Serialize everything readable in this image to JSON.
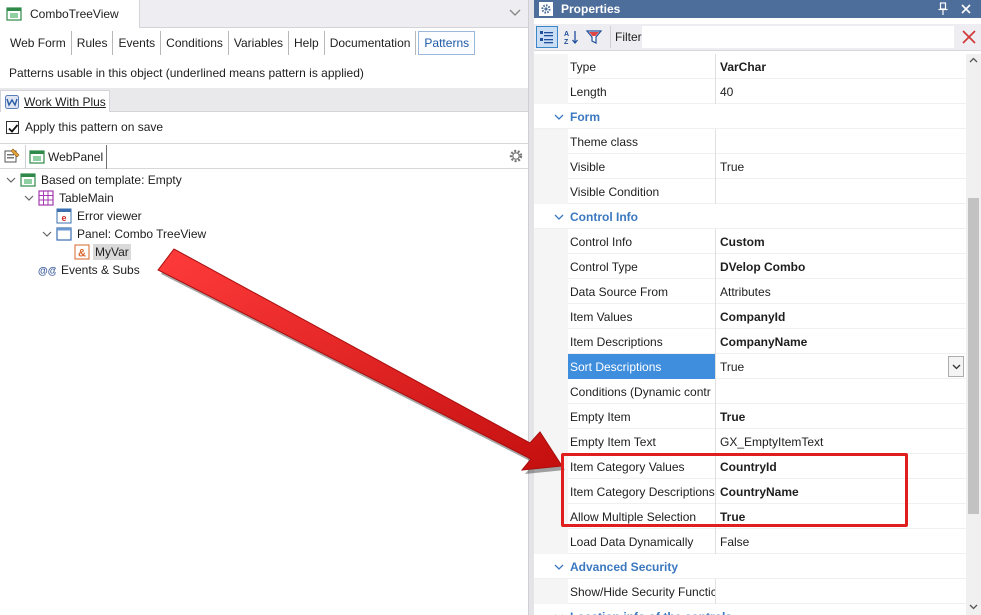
{
  "document": {
    "tab_title": "ComboTreeView"
  },
  "object_tabs": [
    {
      "label": "Web Form",
      "active": false
    },
    {
      "label": "Rules",
      "active": false
    },
    {
      "label": "Events",
      "active": false
    },
    {
      "label": "Conditions",
      "active": false
    },
    {
      "label": "Variables",
      "active": false
    },
    {
      "label": "Help",
      "active": false
    },
    {
      "label": "Documentation",
      "active": false
    },
    {
      "label": "Patterns",
      "active": true
    }
  ],
  "patterns": {
    "description": "Patterns usable in this object (underlined means pattern is applied)",
    "pattern_tab": "Work With Plus",
    "apply_on_save_label": "Apply this pattern on save",
    "apply_on_save_checked": true,
    "instance_tab": "WebPanel"
  },
  "tree": [
    {
      "label": "Based on template: Empty",
      "icon": "webpanel-icon",
      "expanded": true
    },
    {
      "label": "TableMain",
      "icon": "table-icon",
      "expanded": true
    },
    {
      "label": "Error viewer",
      "icon": "error-viewer-icon"
    },
    {
      "label": "Panel: Combo TreeView",
      "icon": "panel-icon",
      "expanded": true
    },
    {
      "label": "MyVar",
      "icon": "variable-icon",
      "selected": true
    },
    {
      "label": "Events & Subs",
      "icon": "events-icon"
    }
  ],
  "properties": {
    "title": "Properties",
    "filter_label": "Filter",
    "filter_value": "",
    "rows": [
      {
        "kind": "prop",
        "name": "Type",
        "value": "VarChar",
        "bold": true
      },
      {
        "kind": "prop",
        "name": "Length",
        "value": "40",
        "bold": false
      },
      {
        "kind": "category",
        "name": "Form"
      },
      {
        "kind": "prop",
        "name": "Theme class",
        "value": "",
        "bold": false
      },
      {
        "kind": "prop",
        "name": "Visible",
        "value": "True",
        "bold": false
      },
      {
        "kind": "prop",
        "name": "Visible Condition",
        "value": "",
        "bold": false
      },
      {
        "kind": "category",
        "name": "Control Info"
      },
      {
        "kind": "prop",
        "name": "Control Info",
        "value": "Custom",
        "bold": true
      },
      {
        "kind": "prop",
        "name": "Control Type",
        "value": "DVelop Combo",
        "bold": true
      },
      {
        "kind": "prop",
        "name": "Data Source From",
        "value": "Attributes",
        "bold": false
      },
      {
        "kind": "prop",
        "name": "Item Values",
        "value": "CompanyId",
        "bold": true
      },
      {
        "kind": "prop",
        "name": "Item Descriptions",
        "value": "CompanyName",
        "bold": true
      },
      {
        "kind": "prop",
        "name": "Sort Descriptions",
        "value": "True",
        "bold": false,
        "selected": true
      },
      {
        "kind": "prop",
        "name": "Conditions (Dynamic contr",
        "value": "",
        "bold": false
      },
      {
        "kind": "prop",
        "name": "Empty Item",
        "value": "True",
        "bold": true
      },
      {
        "kind": "prop",
        "name": "Empty Item Text",
        "value": "GX_EmptyItemText",
        "bold": false
      },
      {
        "kind": "prop",
        "name": "Item Category Values",
        "value": "CountryId",
        "bold": true
      },
      {
        "kind": "prop",
        "name": "Item Category Descriptions",
        "value": "CountryName",
        "bold": true
      },
      {
        "kind": "prop",
        "name": "Allow Multiple Selection",
        "value": "True",
        "bold": true
      },
      {
        "kind": "prop",
        "name": "Load Data Dynamically",
        "value": "False",
        "bold": false
      },
      {
        "kind": "category",
        "name": "Advanced Security"
      },
      {
        "kind": "prop",
        "name": "Show/Hide Security Functic",
        "value": "",
        "bold": false
      },
      {
        "kind": "category",
        "name": "Location info of the controls"
      }
    ]
  },
  "colors": {
    "title_bar": "#4d6d9a",
    "category_text": "#3a78c0",
    "selection": "#3f8ede",
    "annotation_red": "#e01e1e"
  }
}
